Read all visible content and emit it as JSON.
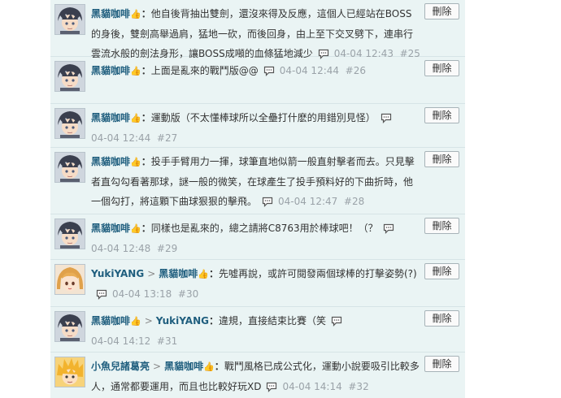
{
  "comments": [
    {
      "author": "黑貓咖啡",
      "reply_to": "",
      "text": "他自後背抽出雙劍，還沒來得及反應，這個人已經站在BOSS的身後，雙劍高舉過肩，猛地一砍，而後回身，由上至下交叉劈下，連串行雲流水般的劍法身形，讓BOSS成噸的血條猛地減少",
      "time": "04-04 12:43",
      "floor": "#25",
      "delete_label": "刪除",
      "avatar": "dark-hair-boy"
    },
    {
      "author": "黑貓咖啡",
      "reply_to": "",
      "text": "上面是亂來的戰鬥版@@",
      "time": "04-04 12:44",
      "floor": "#26",
      "delete_label": "刪除",
      "avatar": "dark-hair-boy"
    },
    {
      "author": "黑貓咖啡",
      "reply_to": "",
      "text": "運動版（不太懂棒球所以全壘打什麽的用錯別見怪）",
      "time": "04-04 12:44",
      "floor": "#27",
      "delete_label": "刪除",
      "avatar": "dark-hair-boy"
    },
    {
      "author": "黑貓咖啡",
      "reply_to": "",
      "text": "投手手臂用力一揮，球筆直地似箭一般直射擊者而去。只見擊者直勾勾看著那球，謎一般的微笑，在球產生了投手預料好的下曲折時，他一個勾打，將這顆下曲球狠狠的擊飛。",
      "time": "04-04 12:47",
      "floor": "#28",
      "delete_label": "刪除",
      "avatar": "dark-hair-boy"
    },
    {
      "author": "黑貓咖啡",
      "reply_to": "",
      "text": "同樣也是亂來的，總之請將C8763用於棒球吧！（？",
      "time": "04-04 12:48",
      "floor": "#29",
      "delete_label": "刪除",
      "avatar": "dark-hair-boy"
    },
    {
      "author": "YukiYANG",
      "reply_to": "黑貓咖啡",
      "text": "先噓再說，或許可閱發兩個球棒的打擊姿勢(?)",
      "time": "04-04 13:18",
      "floor": "#30",
      "delete_label": "刪除",
      "avatar": "orange-hair-girl"
    },
    {
      "author": "黑貓咖啡",
      "reply_to": "YukiYANG",
      "text": "違規，直接結束比賽（笑",
      "time": "04-04 14:12",
      "floor": "#31",
      "delete_label": "刪除",
      "avatar": "dark-hair-boy"
    },
    {
      "author": "小魚兒諸葛亮",
      "reply_to": "黑貓咖啡",
      "text": "戰鬥風格已成公式化，運動小說要吸引比較多人，通常都要運用，而且也比較好玩XD",
      "time": "04-04 14:14",
      "floor": "#32",
      "delete_label": "刪除",
      "avatar": "spiky-blond-boy"
    }
  ],
  "colors": {
    "panel_bg": "#eaf4f4",
    "author": "#1f5e7e",
    "meta": "#9aa2a8",
    "divider": "#d6e4e6"
  },
  "icons": {
    "author_badge": "thumbs-up-icon",
    "reply_arrow": ">",
    "comment_action": "chat-bubble-icon"
  }
}
